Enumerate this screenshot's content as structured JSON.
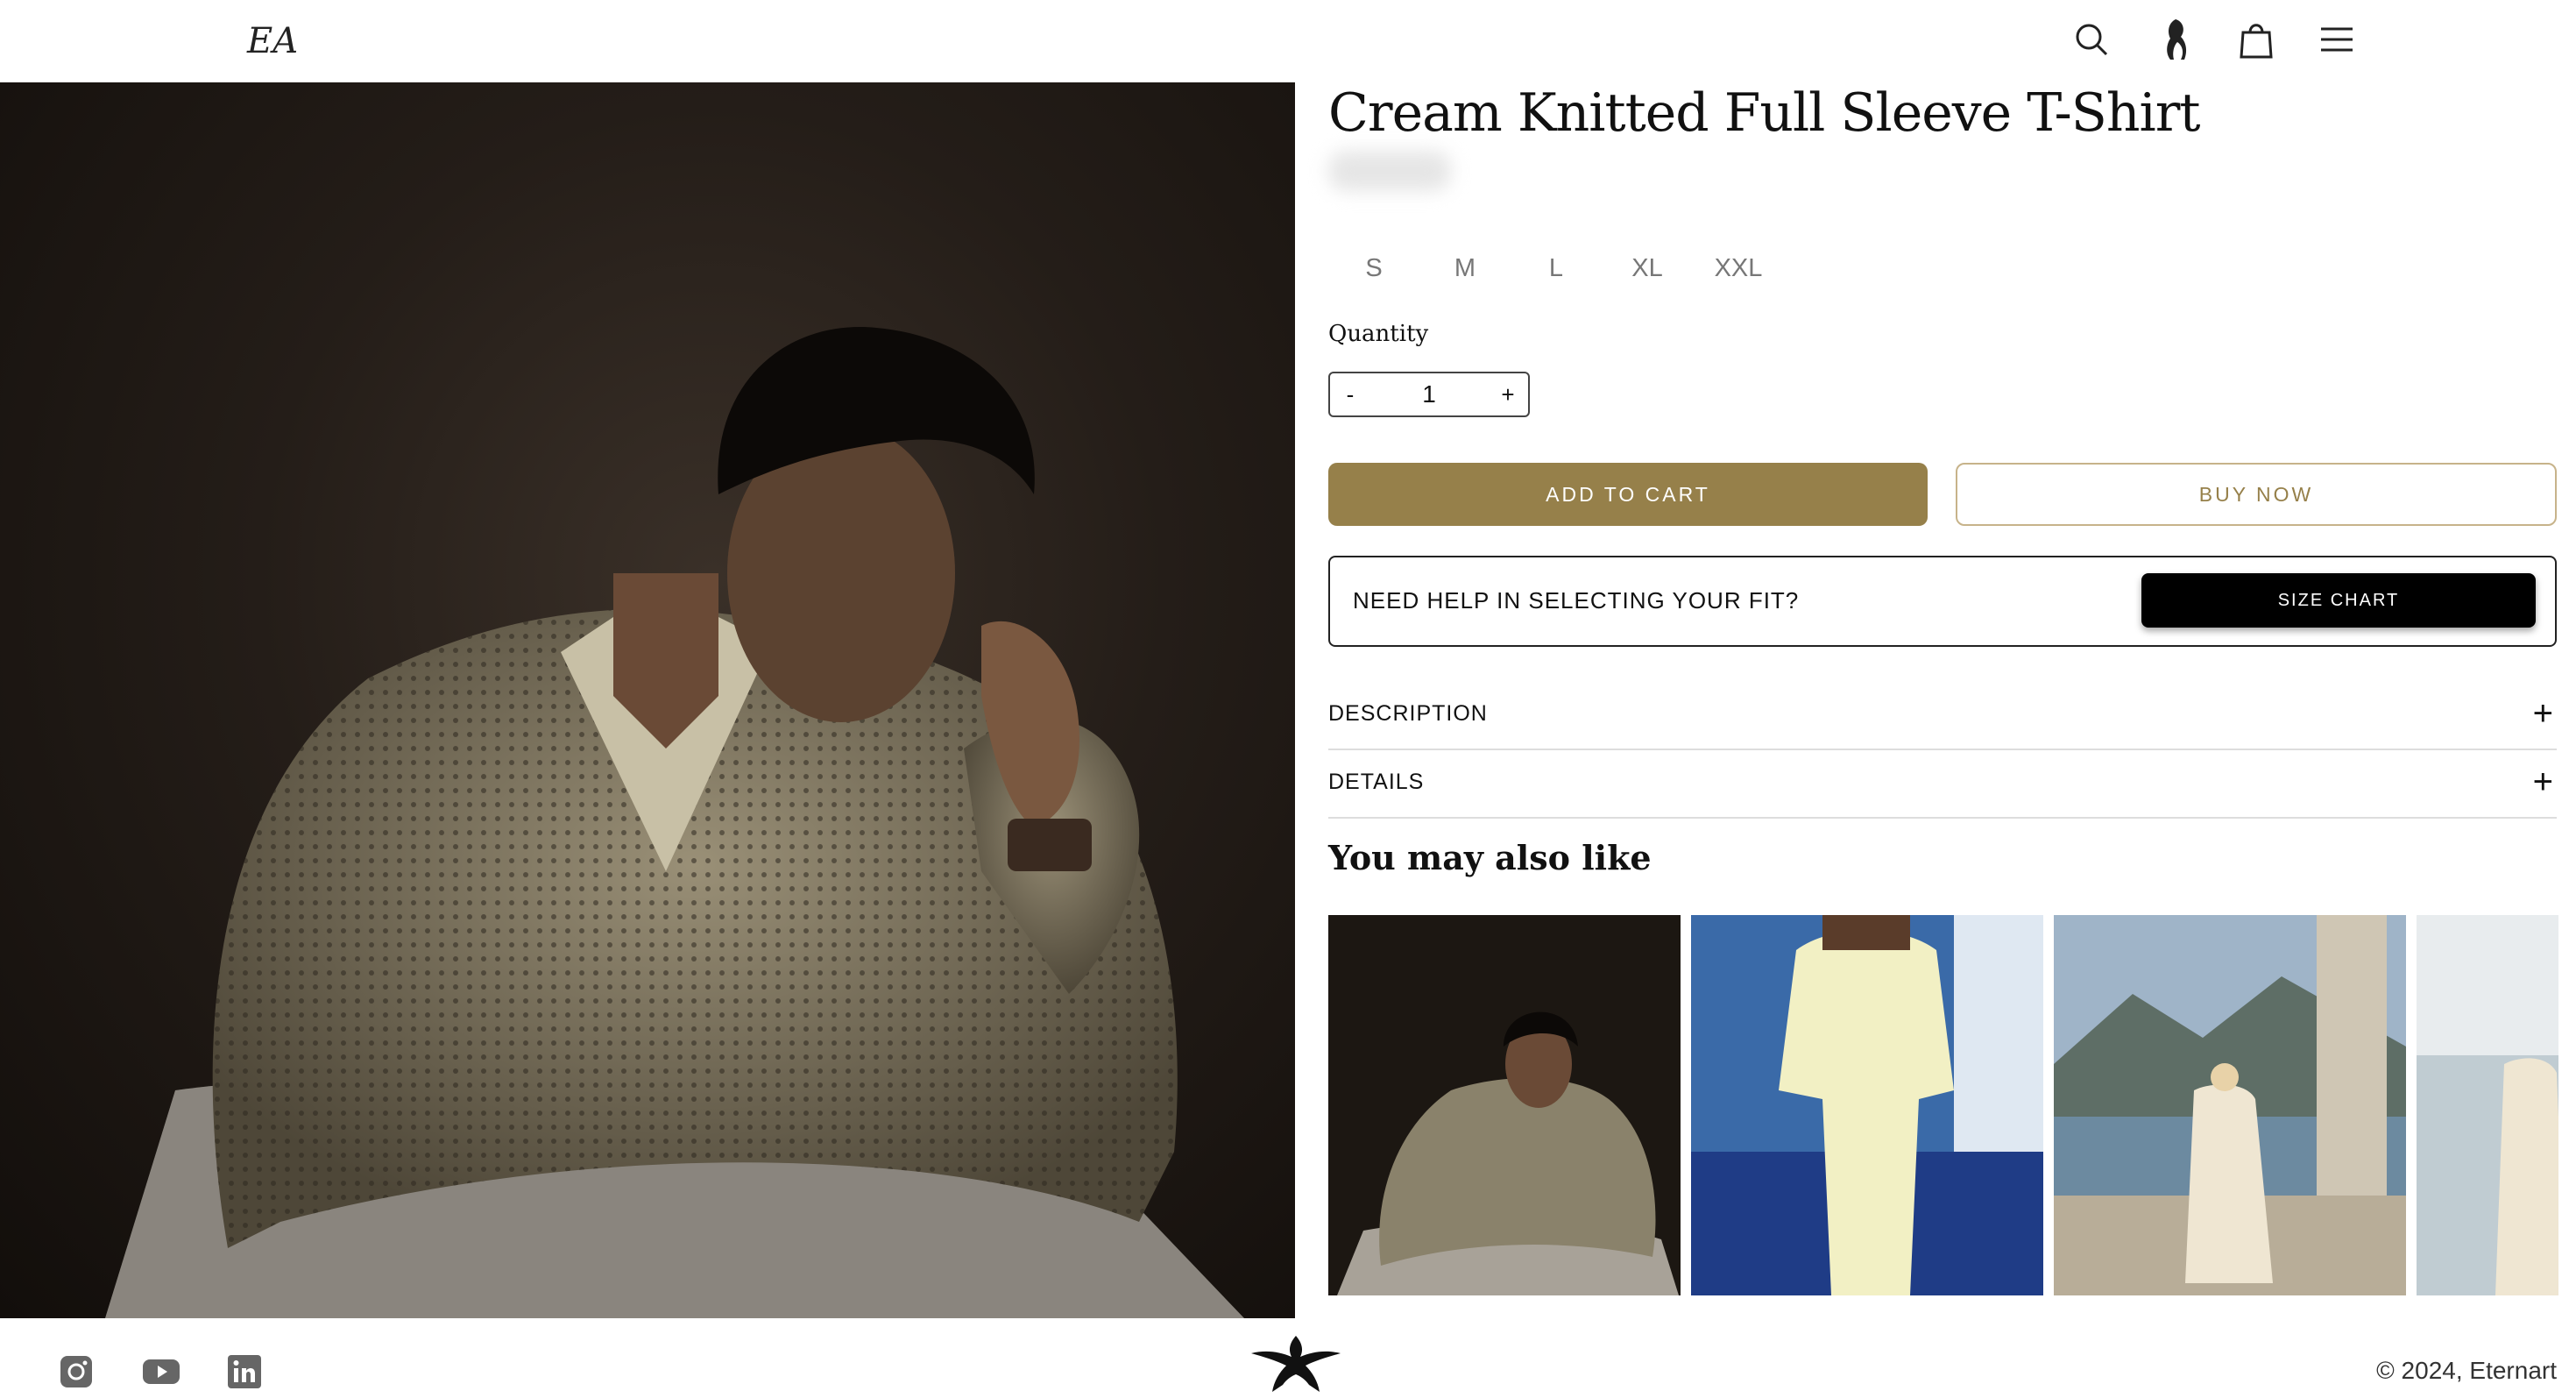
{
  "header": {
    "logo_alt": "EA",
    "icons": [
      "search-icon",
      "brand-figure-icon",
      "cart-bag-icon",
      "menu-icon"
    ]
  },
  "product": {
    "title": "Cream Knitted Full Sleeve T-Shirt",
    "sizes": [
      "S",
      "M",
      "L",
      "XL",
      "XXL"
    ],
    "quantity_label": "Quantity",
    "quantity": {
      "minus": "-",
      "value": "1",
      "plus": "+"
    },
    "add_to_cart": "ADD TO CART",
    "buy_now": "BUY NOW",
    "help_text": "NEED HELP IN SELECTING YOUR FIT?",
    "size_chart": "SIZE CHART",
    "accordions": [
      {
        "label": "DESCRIPTION",
        "icon": "+"
      },
      {
        "label": "DETAILS",
        "icon": "+"
      }
    ]
  },
  "recommendations": {
    "heading": "You may also like"
  },
  "footer": {
    "social": [
      "instagram-icon",
      "youtube-icon",
      "linkedin-icon"
    ],
    "copyright": "© 2024, Eternart"
  },
  "colors": {
    "accent": "#96804a",
    "accent_border": "#c7b38a",
    "dark": "#000000"
  }
}
